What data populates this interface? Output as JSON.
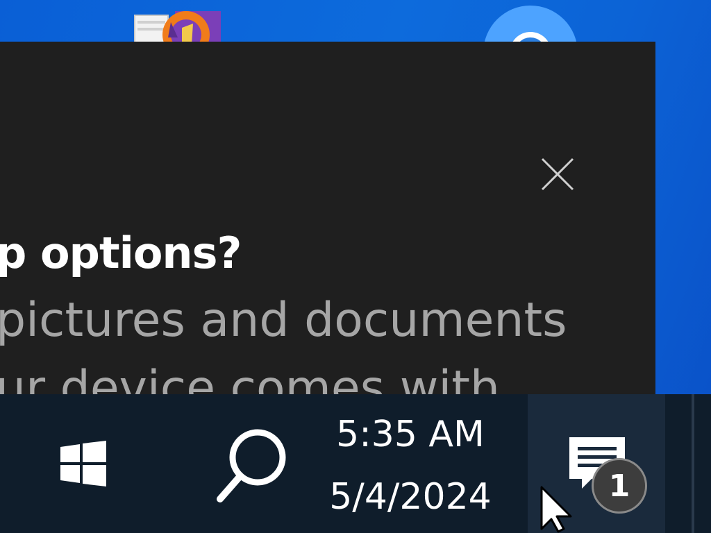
{
  "dialog": {
    "title": "p options?",
    "body_line1": "pictures and documents",
    "body_line2": "ur device comes with"
  },
  "taskbar": {
    "time": "5:35 AM",
    "date": "5/4/2024",
    "notification_count": "1"
  },
  "icons": {
    "close": "close-icon",
    "start": "windows-logo-icon",
    "search": "search-icon",
    "action_center": "message-icon",
    "desktop_paint": "paint-app-icon",
    "desktop_chrome": "chrome-icon",
    "cursor": "mouse-pointer-icon"
  },
  "colors": {
    "desktop_bg": "#0c63d6",
    "dialog_bg": "#1f1f1f",
    "taskbar_bg": "#0f1d2b",
    "title_text": "#ffffff",
    "body_text": "#a6a6a6"
  }
}
